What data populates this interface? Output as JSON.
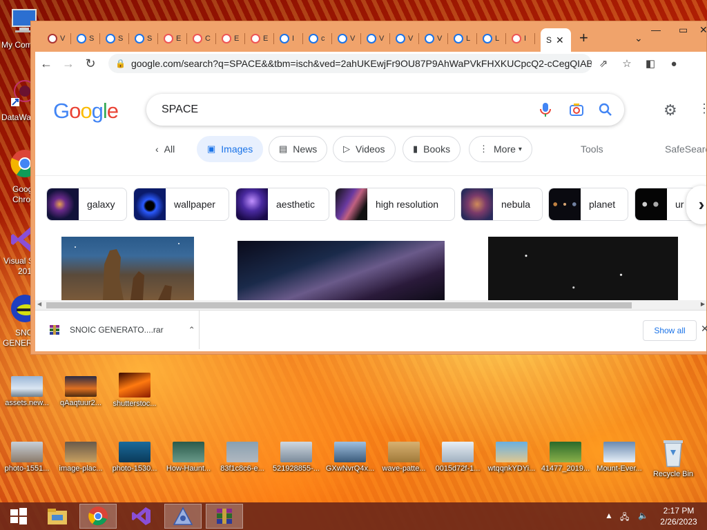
{
  "desktop": {
    "left_icons": [
      {
        "label": "My Com",
        "icon": "computer-icon"
      },
      {
        "label": "DataWa",
        "icon": "datawarehouse-icon"
      },
      {
        "label": "Goog",
        "label2": "Chro",
        "icon": "chrome-icon"
      },
      {
        "label": "Visual S",
        "label2": "201",
        "icon": "visual-studio-icon"
      },
      {
        "label": "SNO",
        "label2": "GENERA",
        "icon": "snoic-generator-icon"
      }
    ],
    "row1": [
      "assets.new...",
      "qAaqtuur2...",
      "shutterstoc..."
    ],
    "row2": [
      "photo-1551...",
      "image-plac...",
      "photo-1530...",
      "How-Haunt...",
      "83f1c8c6-e...",
      "521928855-...",
      "GXwNvrQ4x...",
      "wave-patte...",
      "0015d72f-1...",
      "wtqqnkYDYi...",
      "41477_2019...",
      "Mount-Ever...",
      "Recycle Bin"
    ]
  },
  "browser": {
    "active_tab_label": "S",
    "mini_tabs": [
      "V",
      "S",
      "S",
      "S",
      "E",
      "C",
      "E",
      "E",
      "I",
      "c",
      "V",
      "V",
      "V",
      "V",
      "L",
      "L",
      "I"
    ],
    "url": "google.com/search?q=SPACE&&tbm=isch&ved=2ahUKEwjFr9OU87P9AhWaPVkFHXKUCpcQ2-cCegQIABA...",
    "search_query": "SPACE",
    "filters": {
      "all": "All",
      "images": "Images",
      "news": "News",
      "videos": "Videos",
      "books": "Books",
      "more": "More",
      "tools": "Tools",
      "safesearch": "SafeSearc"
    },
    "related": [
      "galaxy",
      "wallpaper",
      "aesthetic",
      "high resolution",
      "nebula",
      "planet",
      "ur"
    ],
    "download": {
      "filename": "SNOIC GENERATO....rar",
      "show_all": "Show all"
    }
  },
  "taskbar": {
    "time": "2:17 PM",
    "date": "2/26/2023"
  },
  "colors": {
    "google_blue": "#4285f4",
    "google_red": "#ea4335",
    "google_yellow": "#fbbc05",
    "google_green": "#34a853",
    "window_frame": "#f0a36b",
    "link_blue": "#1a73e8"
  }
}
